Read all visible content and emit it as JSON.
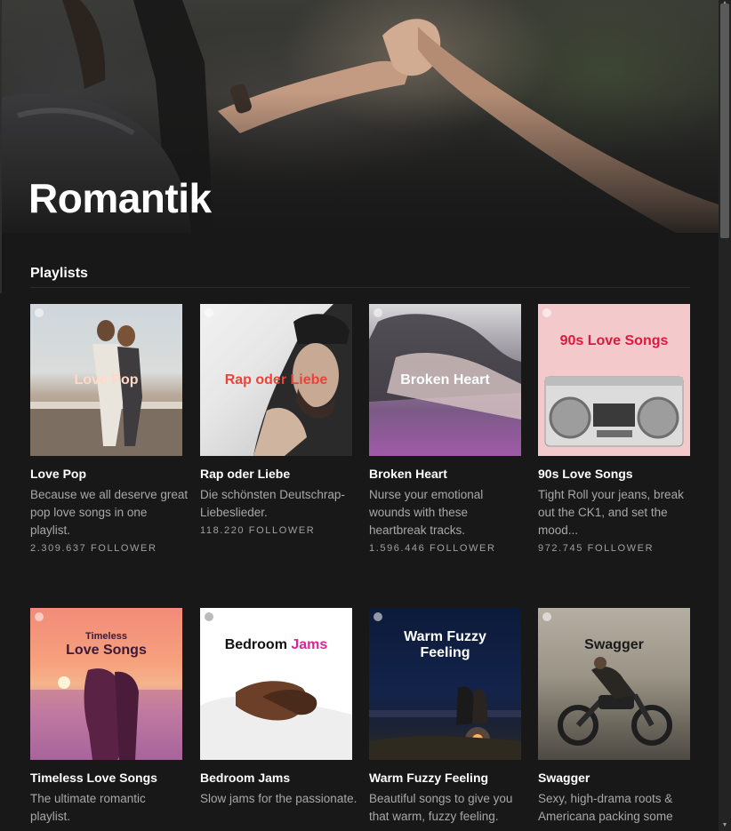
{
  "page": {
    "title": "Romantik"
  },
  "section": {
    "title": "Playlists"
  },
  "playlists": [
    {
      "cover_text": "Love Pop",
      "title": "Love Pop",
      "description": "Because we all deserve great pop love songs in one playlist.",
      "followers": "2.309.637 FOLLOWER"
    },
    {
      "cover_text": "Rap oder Liebe",
      "title": "Rap oder Liebe",
      "description": "Die schönsten Deutschrap-Liebeslieder.",
      "followers": "118.220 FOLLOWER"
    },
    {
      "cover_text": "Broken Heart",
      "title": "Broken Heart",
      "description": "Nurse your emotional wounds with these heartbreak tracks.",
      "followers": "1.596.446 FOLLOWER"
    },
    {
      "cover_text": "90s Love Songs",
      "title": "90s Love Songs",
      "description": "Tight Roll your jeans, break out the CK1, and set the mood...",
      "followers": "972.745 FOLLOWER"
    },
    {
      "cover_text_line1": "Timeless",
      "cover_text_line2": "Love Songs",
      "title": "Timeless Love Songs",
      "description": "The ultimate romantic playlist."
    },
    {
      "cover_text_part1": "Bedroom ",
      "cover_text_part2": "Jams",
      "title": "Bedroom Jams",
      "description": "Slow jams for the passionate."
    },
    {
      "cover_text_line1": "Warm Fuzzy",
      "cover_text_line2": "Feeling",
      "title": "Warm Fuzzy Feeling",
      "description": "Beautiful songs to give you that warm, fuzzy feeling."
    },
    {
      "cover_text": "Swagger",
      "title": "Swagger",
      "description": "Sexy, high-drama roots & Americana packing some"
    }
  ],
  "colors": {
    "background": "#181818",
    "rap_title": "#e8443a",
    "nineties_title": "#e0183c",
    "bedroom_accent": "#e0229a"
  },
  "icons": [
    "spotify-logo-icon",
    "scroll-up-arrow-icon",
    "scroll-down-arrow-icon"
  ]
}
